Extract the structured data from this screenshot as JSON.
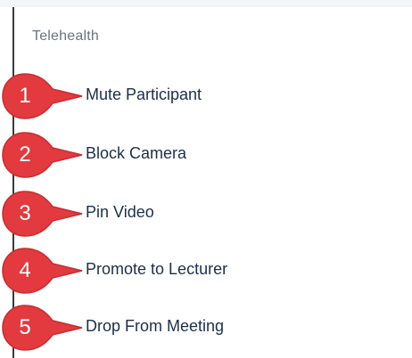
{
  "menu": {
    "header": "Telehealth",
    "items": [
      {
        "number": "1",
        "label": "Mute Participant"
      },
      {
        "number": "2",
        "label": "Block Camera"
      },
      {
        "number": "3",
        "label": "Pin Video"
      },
      {
        "number": "4",
        "label": "Promote to Lecturer"
      },
      {
        "number": "5",
        "label": "Drop From Meeting"
      }
    ]
  },
  "colors": {
    "callout": "#e23a3f",
    "text": "#1c2f4a",
    "header": "#6b7580"
  },
  "icons": [
    "callout-marker-icon"
  ]
}
